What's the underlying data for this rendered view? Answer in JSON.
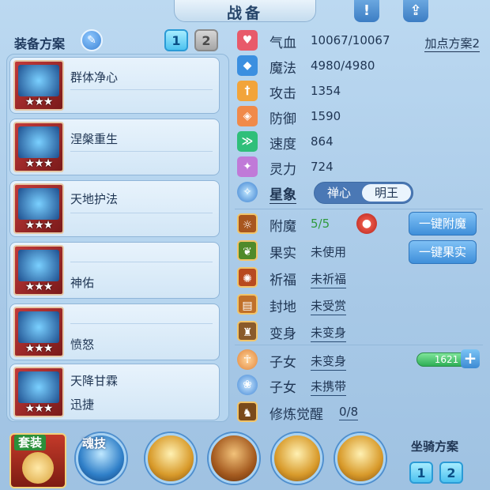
{
  "title": "战备",
  "header_icons": {
    "info": "!",
    "share": "share-icon"
  },
  "equip": {
    "heading": "装备方案",
    "plans": [
      "1",
      "2"
    ],
    "active_plan": "1",
    "slots": [
      {
        "name": "群体净心",
        "sub": "",
        "stars": "★★★"
      },
      {
        "name": "涅槃重生",
        "sub": "",
        "stars": "★★★"
      },
      {
        "name": "天地护法",
        "sub": "",
        "stars": "★★★"
      },
      {
        "name": "",
        "sub": "神佑",
        "stars": "★★★"
      },
      {
        "name": "",
        "sub": "愤怒",
        "stars": "★★★"
      },
      {
        "name": "天降甘霖",
        "sub": "迅捷",
        "stars": "★★★"
      }
    ]
  },
  "stats": [
    {
      "label": "气血",
      "value": "10067/10067",
      "color": "#e85a6a"
    },
    {
      "label": "魔法",
      "value": "4980/4980",
      "color": "#3b8fe0"
    },
    {
      "label": "攻击",
      "value": "1354",
      "color": "#f2a43a"
    },
    {
      "label": "防御",
      "value": "1590",
      "color": "#f08a4a"
    },
    {
      "label": "速度",
      "value": "864",
      "color": "#2fbf7a"
    },
    {
      "label": "灵力",
      "value": "724",
      "color": "#c07ad8"
    }
  ],
  "add_plan": "加点方案2",
  "xingxiang": {
    "label": "星象",
    "options": [
      "禅心",
      "明王"
    ],
    "selected": "明王"
  },
  "extras": [
    {
      "label": "附魔",
      "value": "5/5"
    },
    {
      "label": "果实",
      "value": "未使用"
    },
    {
      "label": "祈福",
      "value": "未祈福"
    },
    {
      "label": "封地",
      "value": "未受赏"
    },
    {
      "label": "变身",
      "value": "未变身"
    },
    {
      "label": "子女",
      "value": "未变身"
    },
    {
      "label": "子女",
      "value": "未携带"
    },
    {
      "label": "修炼觉醒",
      "value": "0/8"
    }
  ],
  "buttons": {
    "enchant": "一键附魔",
    "fruit": "一键果实"
  },
  "child_value": "1621",
  "bottom": {
    "suit": "套装",
    "soul": "魂技",
    "mount": "坐骑方案",
    "mount_plans": [
      "1",
      "2"
    ]
  }
}
